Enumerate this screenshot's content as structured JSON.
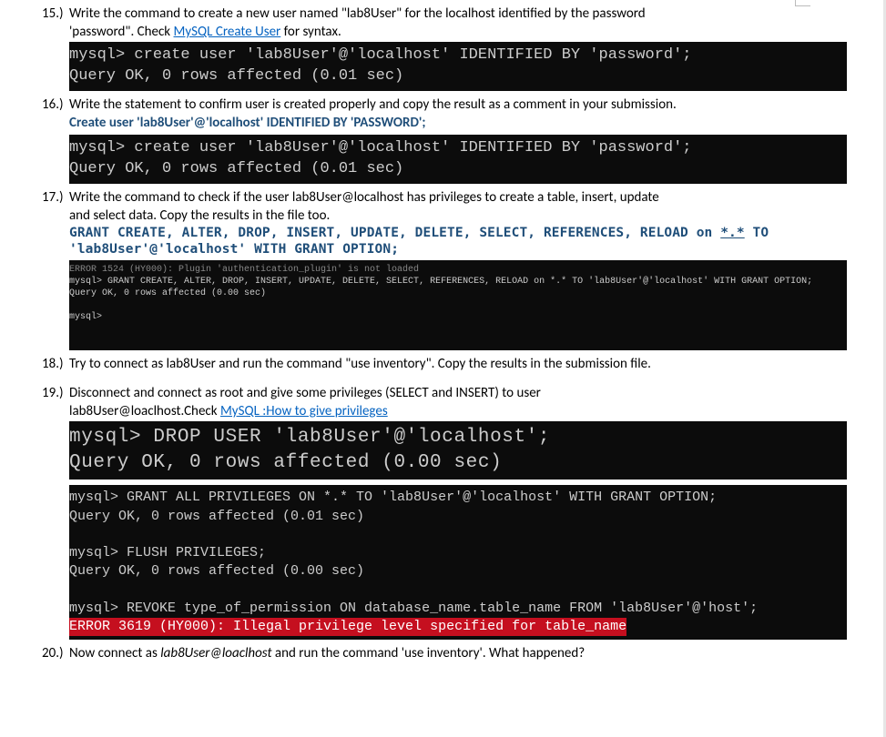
{
  "q15": {
    "num": "15.)",
    "text_a": "Write the command to create a new user named \"lab8User\" for the localhost identified by the password",
    "text_b": "'password\". Check ",
    "link": "MySQL Create User",
    "text_c": " for syntax.",
    "term": "mysql> create user 'lab8User'@'localhost' IDENTIFIED BY 'password';\nQuery OK, 0 rows affected (0.01 sec)"
  },
  "q16": {
    "num": "16.)",
    "text": "Write the statement to confirm user is created properly and copy the result as a comment in your submission.",
    "code": "Create user 'lab8User'@'localhost' IDENTIFIED BY 'PASSWORD';",
    "term": "mysql> create user 'lab8User'@'localhost' IDENTIFIED BY 'password';\nQuery OK, 0 rows affected (0.01 sec)"
  },
  "q17": {
    "num": "17.)",
    "text_a": "Write the command to check if the user lab8User@localhost has privileges to create a table, insert, update",
    "text_b": "and select data. Copy the results in the file too.",
    "code_a": "GRANT CREATE, ALTER, DROP, INSERT, UPDATE, DELETE, SELECT, REFERENCES, RELOAD on ",
    "code_wild": "*.*",
    "code_a2": " TO",
    "code_b": "'lab8User'@'localhost' WITH GRANT OPTION;",
    "term_err": "ERROR 1524 (HY000): Plugin 'authentication_plugin' is not loaded",
    "term_main": "mysql> GRANT CREATE, ALTER, DROP, INSERT, UPDATE, DELETE, SELECT, REFERENCES, RELOAD on *.* TO 'lab8User'@'localhost' WITH GRANT OPTION;\nQuery OK, 0 rows affected (0.00 sec)\n\nmysql>"
  },
  "q18": {
    "num": "18.)",
    "text": "Try to connect as lab8User and run the command \"use inventory\". Copy the results in the submission file."
  },
  "q19": {
    "num": "19.)",
    "text_a": "Disconnect and connect as root and give some privileges (SELECT and INSERT) to user",
    "text_b_pre": "lab8User@loaclhost.",
    "text_b_mid": "Check ",
    "link": "MySQL :How to give privileges",
    "term_drop": "mysql> DROP USER 'lab8User'@'localhost';\nQuery OK, 0 rows affected (0.00 sec)",
    "term_priv": "mysql> GRANT ALL PRIVILEGES ON *.* TO 'lab8User'@'localhost' WITH GRANT OPTION;\nQuery OK, 0 rows affected (0.01 sec)\n\nmysql> FLUSH PRIVILEGES;\nQuery OK, 0 rows affected (0.00 sec)\n\nmysql> REVOKE type_of_permission ON database_name.table_name FROM 'lab8User'@'host';",
    "term_err": "ERROR 3619 (HY000): Illegal privilege level specified for table_name"
  },
  "q20": {
    "num": "20.)",
    "text_a": "Now connect as ",
    "italic": "lab8User@loaclhost",
    "text_b": " and run the command 'use inventory'. What happened?"
  }
}
